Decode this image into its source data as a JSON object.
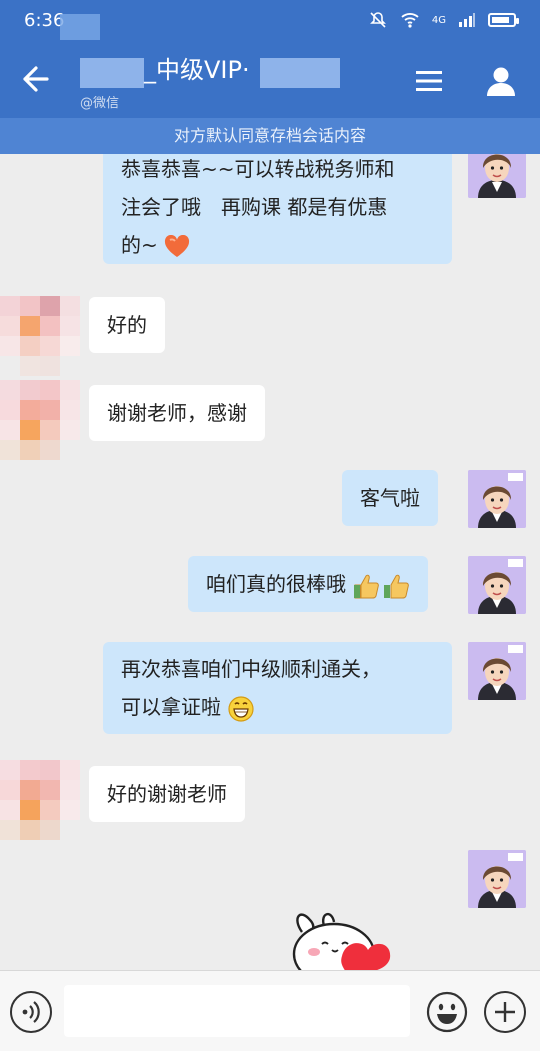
{
  "status_bar": {
    "time": "6:36",
    "network": "4G"
  },
  "header": {
    "title": "_中级VIP·",
    "subtitle": "@微信"
  },
  "notice": "对方默认同意存档会话内容",
  "messages": [
    {
      "side": "out",
      "lines": [
        "恭喜恭喜~~可以转战税务师和",
        "注会了哦　再购课 都是有优惠",
        "的~"
      ]
    },
    {
      "side": "in",
      "text": "好的"
    },
    {
      "side": "in",
      "text": "谢谢老师，感谢"
    },
    {
      "side": "out",
      "text": "客气啦"
    },
    {
      "side": "out",
      "text": "咱们真的很棒哦"
    },
    {
      "side": "out",
      "lines": [
        "再次恭喜咱们中级顺利通关，",
        "可以拿证啦"
      ]
    },
    {
      "side": "in",
      "text": "好的谢谢老师"
    }
  ],
  "colors": {
    "header": "#3b72c6",
    "notice_bar": "#4f84d3",
    "outgoing_bubble": "#cde6fb",
    "incoming_bubble": "#ffffff",
    "chat_background": "#ededed"
  },
  "icons": {
    "back": "arrow-left-icon",
    "menu": "hamburger-menu-icon",
    "profile": "user-icon",
    "voice": "voice-icon",
    "emoji": "smiley-icon",
    "more": "plus-icon"
  }
}
